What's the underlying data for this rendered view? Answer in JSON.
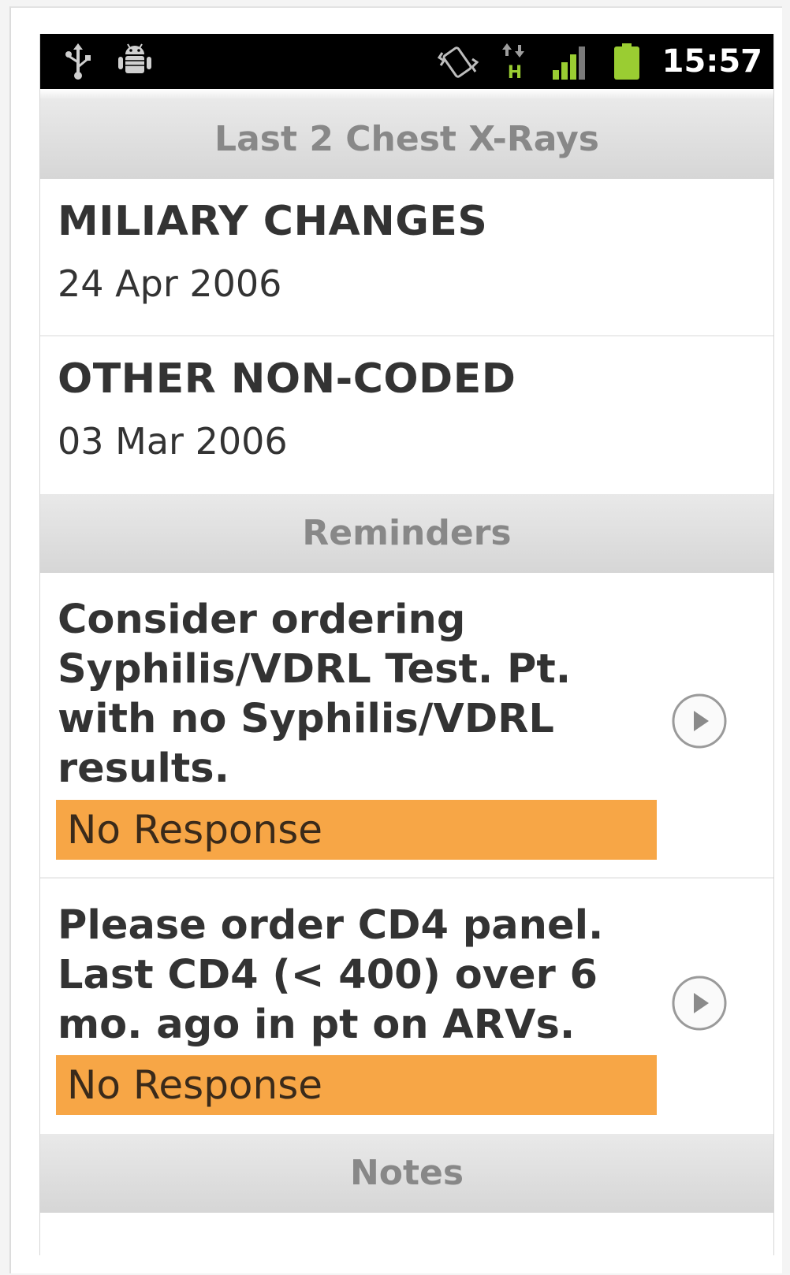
{
  "status_bar": {
    "time": "15:57",
    "icons": [
      "usb-icon",
      "android-debug-icon",
      "vibrate-icon",
      "hspa-data-icon",
      "signal-icon",
      "battery-icon"
    ],
    "accent_color": "#9acd32"
  },
  "sections": {
    "xrays_header": "Last 2 Chest X-Rays",
    "reminders_header": "Reminders",
    "notes_header": "Notes"
  },
  "xrays": [
    {
      "title": "MILIARY CHANGES",
      "date": "24 Apr 2006"
    },
    {
      "title": "OTHER NON-CODED",
      "date": "03 Mar 2006"
    }
  ],
  "reminders": [
    {
      "lines": [
        "Consider ordering",
        "Syphilis/VDRL Test. Pt.",
        "with no Syphilis/VDRL",
        "results."
      ],
      "status": "No Response",
      "action_icon": "chevron-right-circle-icon"
    },
    {
      "lines": [
        "Please order CD4 panel.",
        "Last CD4 (< 400) over 6",
        "mo. ago in pt on ARVs."
      ],
      "status": "No Response",
      "action_icon": "chevron-right-circle-icon"
    }
  ],
  "colors": {
    "status_badge": "#f7a646",
    "section_header_text": "#888888"
  }
}
